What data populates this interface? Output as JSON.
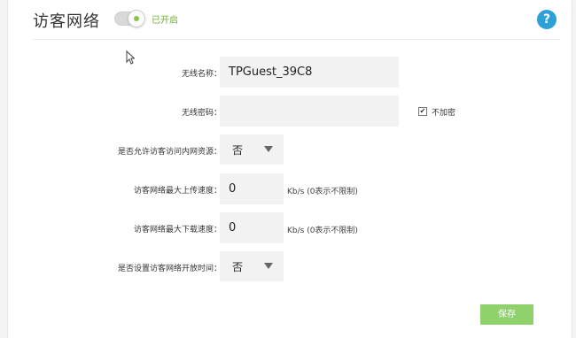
{
  "header": {
    "title": "访客网络",
    "toggle_state": "on",
    "status": "已开启",
    "help_icon": "?"
  },
  "form": {
    "ssid": {
      "label": "无线名称：",
      "value": "TPGuest_39C8"
    },
    "password": {
      "label": "无线密码：",
      "value": "",
      "no_encrypt": {
        "label": "不加密",
        "checked": true
      }
    },
    "allow_intranet": {
      "label": "是否允许访客访问内网资源：",
      "value": "否"
    },
    "upload_limit": {
      "label": "访客网络最大上传速度：",
      "value": "0",
      "unit": "Kb/s (0表示不限制)"
    },
    "download_limit": {
      "label": "访客网络最大下载速度：",
      "value": "0",
      "unit": "Kb/s (0表示不限制)"
    },
    "schedule": {
      "label": "是否设置访客网络开放时间：",
      "value": "否"
    }
  },
  "actions": {
    "save_label": "保存"
  },
  "colors": {
    "accent_green": "#8fd16b",
    "status_green": "#73ad3a",
    "help_blue": "#2da0d8",
    "field_bg": "#f2f2f2"
  }
}
